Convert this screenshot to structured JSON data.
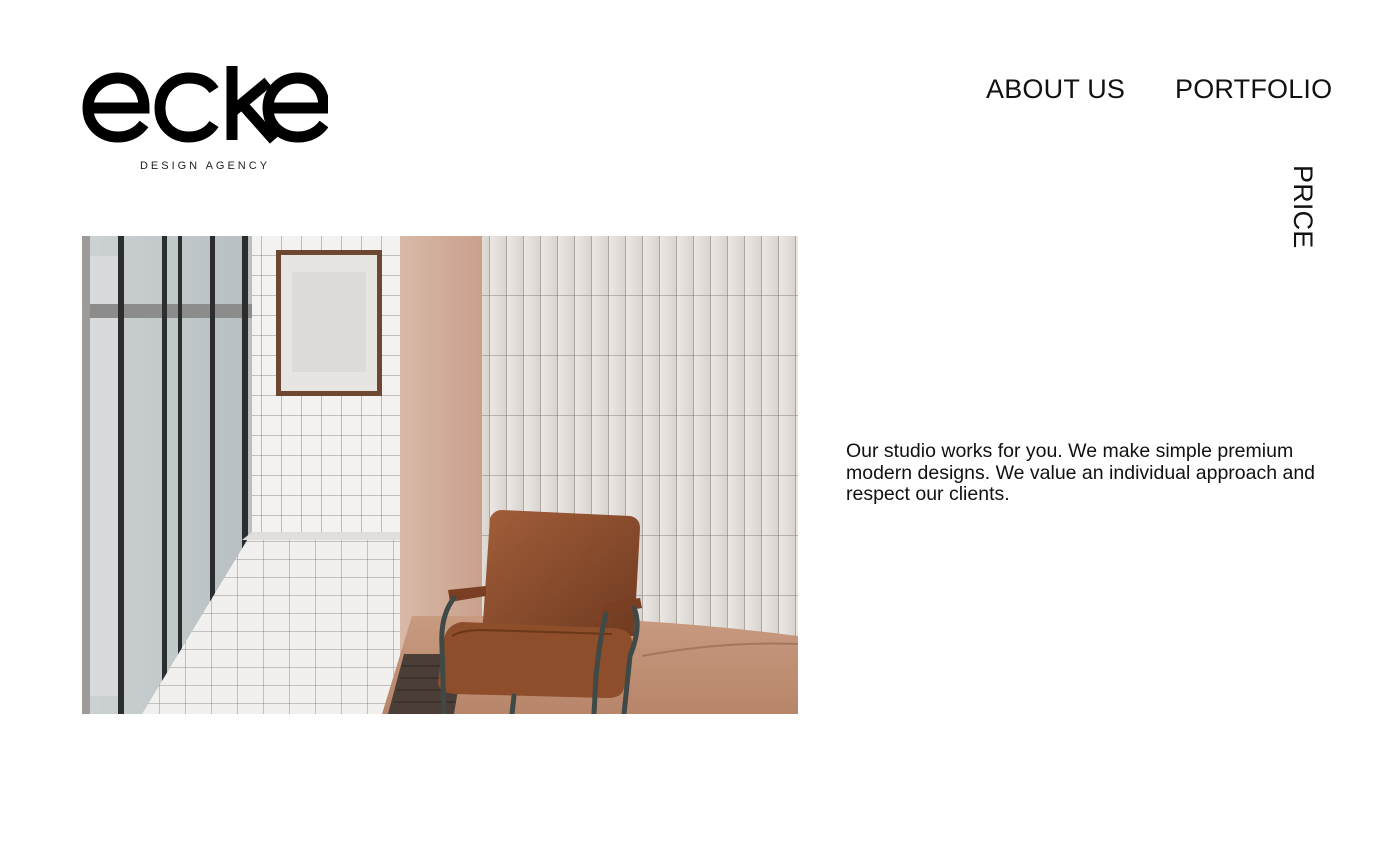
{
  "brand": {
    "name": "ecke",
    "tagline": "DESIGN AGENCY"
  },
  "nav": {
    "about": "ABOUT US",
    "portfolio": "PORTFOLIO",
    "price": "PRICE"
  },
  "intro": {
    "text": "Our studio works for you. We make simple premium modern designs. We value an individual approach and respect our clients."
  },
  "colors": {
    "text": "#111111",
    "background": "#ffffff",
    "chair_leather": "#8a4a2a",
    "wall_tile": "#e9e6e2"
  }
}
